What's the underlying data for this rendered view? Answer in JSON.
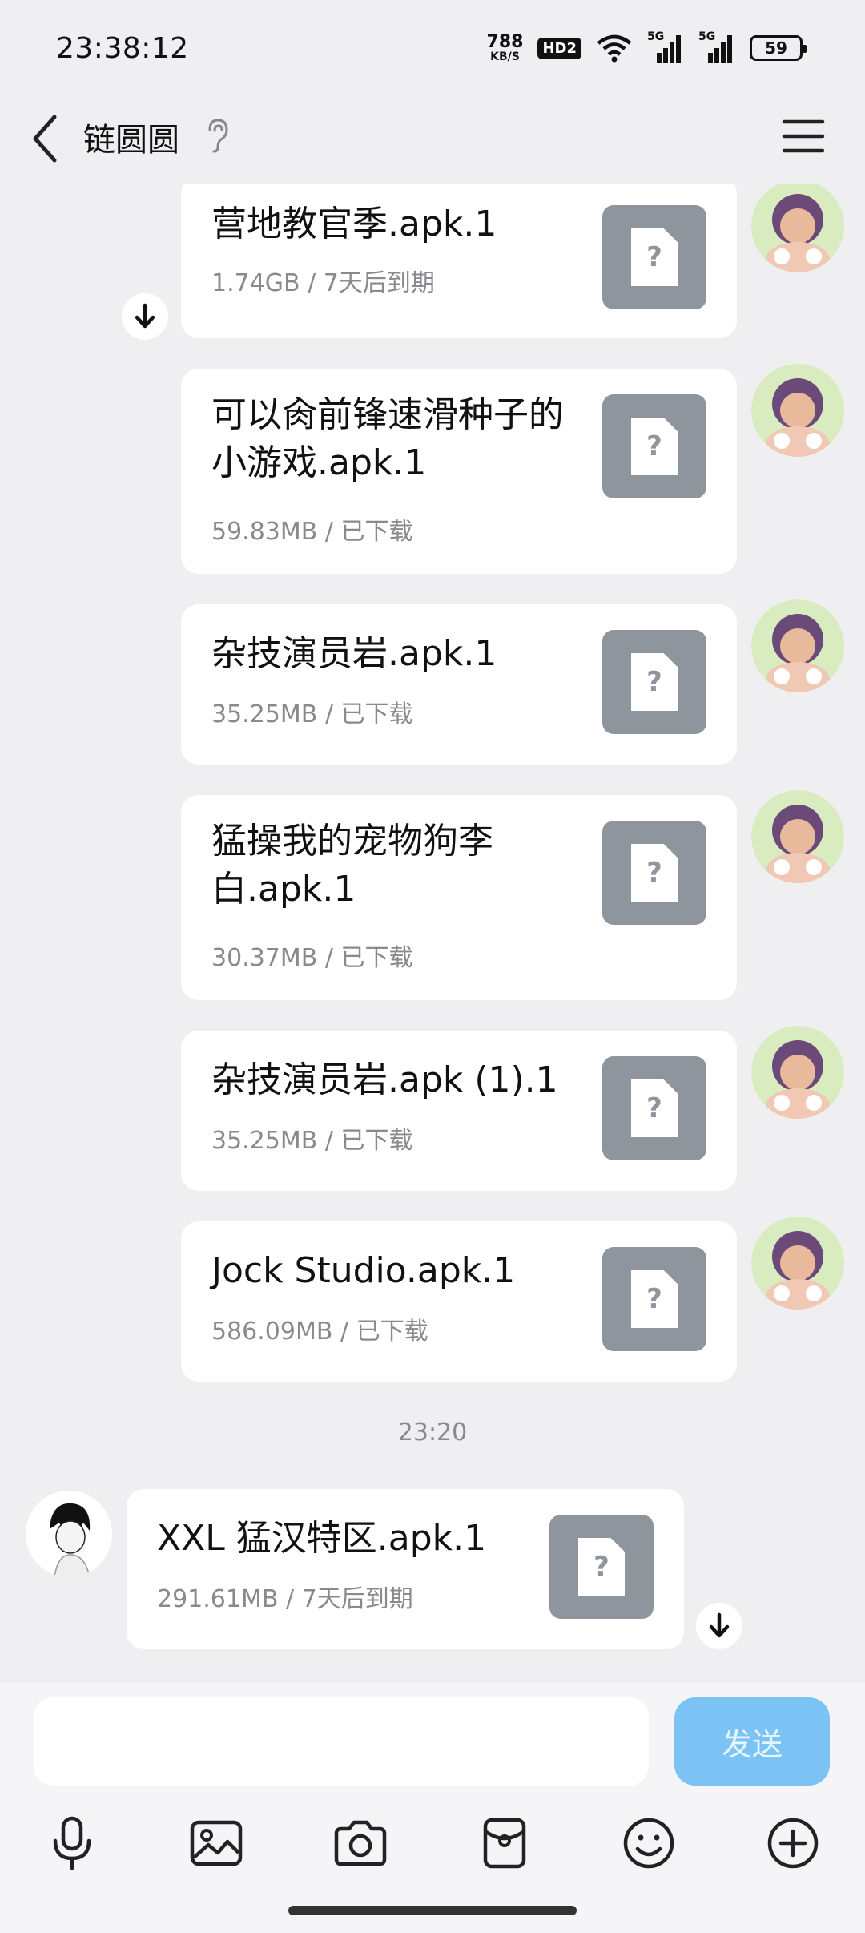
{
  "status_bar": {
    "time": "23:38:12",
    "net_speed_value": "788",
    "net_speed_unit": "KB/S",
    "hd_label": "HD2",
    "signal_label_1": "5G",
    "signal_label_2": "5G",
    "battery": "59"
  },
  "header": {
    "title": "链圆圆"
  },
  "messages": [
    {
      "name": "营地教官季.apk.1",
      "meta": "1.74GB / 7天后到期"
    },
    {
      "name": "可以肏前锋速滑种子的小游戏.apk.1",
      "meta": "59.83MB / 已下载"
    },
    {
      "name": "杂技演员岩.apk.1",
      "meta": "35.25MB / 已下载"
    },
    {
      "name": "猛操我的宠物狗李白.apk.1",
      "meta": "30.37MB / 已下载"
    },
    {
      "name": "杂技演员岩.apk (1).1",
      "meta": "35.25MB / 已下载"
    },
    {
      "name": "Jock Studio.apk.1",
      "meta": "586.09MB / 已下载"
    },
    {
      "name": "XXL 猛汉特区.apk.1",
      "meta": "291.61MB / 7天后到期"
    }
  ],
  "time_separator": "23:20",
  "file_thumb_glyph": "?",
  "input": {
    "send_label": "发送"
  },
  "toolbar_icons": [
    "microphone-icon",
    "image-icon",
    "camera-icon",
    "red-packet-icon",
    "emoji-icon",
    "plus-icon"
  ],
  "colors": {
    "background": "#efeff1",
    "send_button": "#7cc3f5",
    "file_thumb": "#8e959c"
  }
}
